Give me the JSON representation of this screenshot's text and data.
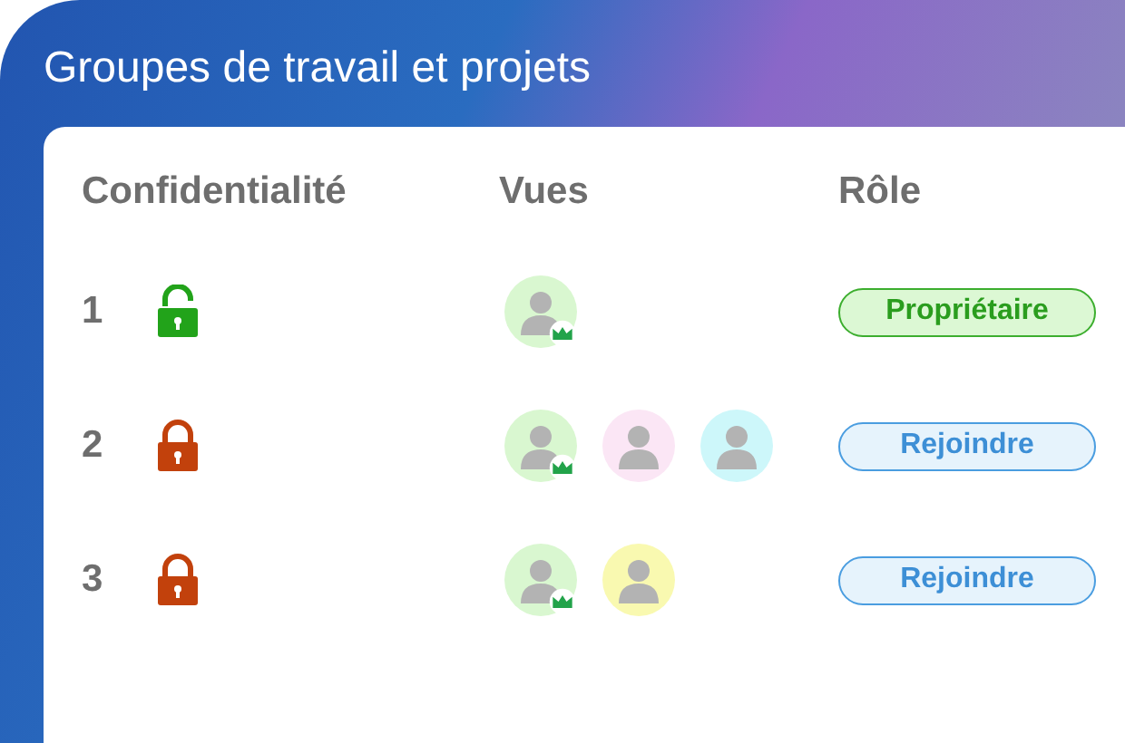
{
  "title": "Groupes de travail et projets",
  "columns": [
    "Confidentialité",
    "Vues",
    "Rôle"
  ],
  "rows": [
    {
      "number": "1",
      "locked": false,
      "avatars": [
        {
          "color": "#d9f7d0",
          "owner": true
        }
      ],
      "role": {
        "label": "Propriétaire",
        "kind": "owner"
      }
    },
    {
      "number": "2",
      "locked": true,
      "avatars": [
        {
          "color": "#d9f7d0",
          "owner": true
        },
        {
          "color": "#fbe6f5",
          "owner": false
        },
        {
          "color": "#cdf7fa",
          "owner": false
        }
      ],
      "role": {
        "label": "Rejoindre",
        "kind": "join"
      }
    },
    {
      "number": "3",
      "locked": true,
      "avatars": [
        {
          "color": "#d9f7d0",
          "owner": true
        },
        {
          "color": "#f9f9b0",
          "owner": false
        }
      ],
      "role": {
        "label": "Rejoindre",
        "kind": "join"
      }
    }
  ]
}
